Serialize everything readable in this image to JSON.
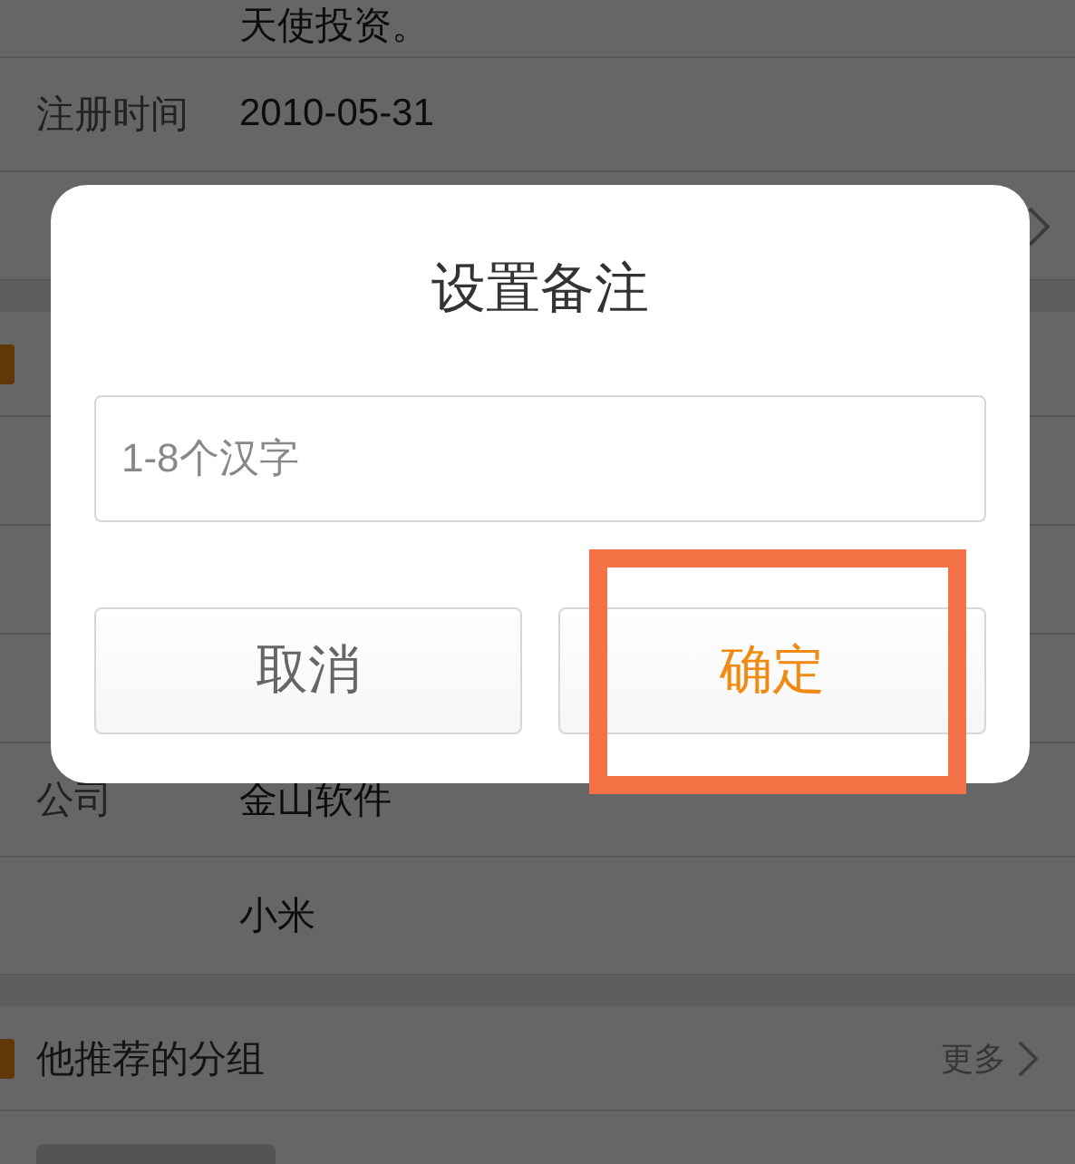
{
  "background": {
    "items": [
      {
        "kind": "text",
        "value": "天使投资。"
      },
      {
        "kind": "field",
        "label": "注册时间",
        "value": "2010-05-31"
      },
      {
        "kind": "link"
      },
      {
        "kind": "gap"
      },
      {
        "kind": "header"
      },
      {
        "kind": "row"
      },
      {
        "kind": "row"
      },
      {
        "kind": "row"
      },
      {
        "kind": "field",
        "label": "公司",
        "value": "金山软件"
      },
      {
        "kind": "field",
        "value": "小米"
      },
      {
        "kind": "gap"
      },
      {
        "kind": "header",
        "title": "他推荐的分组",
        "more": "更多"
      },
      {
        "kind": "thumbnails"
      }
    ]
  },
  "dialog": {
    "title": "设置备注",
    "input": {
      "placeholder": "1-8个汉字"
    },
    "buttons": [
      {
        "label": "取消",
        "kind": "cancel",
        "highlighted": false
      },
      {
        "label": "确定",
        "kind": "confirm",
        "highlighted": true
      }
    ]
  }
}
